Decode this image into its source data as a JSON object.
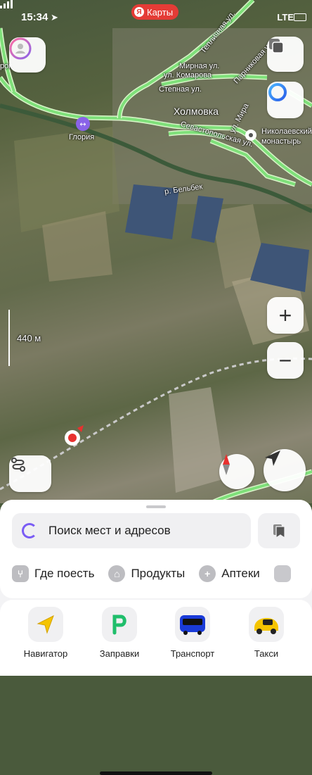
{
  "status_bar": {
    "time": "15:34",
    "network": "LTE"
  },
  "brand": {
    "label": "Карты",
    "logo_letter": "Я"
  },
  "map": {
    "labels": {
      "city": "Холмовка",
      "monastery": "Николаевский монастырь",
      "river": "р. Бельбек",
      "gym": "Глория",
      "streets": [
        "Тепличная ул.",
        "Мирная ул.",
        "ул. Комарова",
        "Степная ул.",
        "Парниковая ул.",
        "ул. Мира",
        "Севастопольская ул."
      ],
      "partial_left": "рок"
    },
    "scale_label": "440 м",
    "colors": {
      "road": "#7fe07a",
      "road_halo": "#d9f5c9",
      "pin": "#e8312f"
    }
  },
  "controls": {
    "zoom_in": "+",
    "zoom_out": "−"
  },
  "search": {
    "placeholder": "Поиск мест и адресов"
  },
  "categories": [
    {
      "icon": "fork-knife-icon",
      "label": "Где поесть"
    },
    {
      "icon": "basket-icon",
      "label": "Продукты"
    },
    {
      "icon": "plus-icon",
      "label": "Аптеки"
    }
  ],
  "apps": [
    {
      "icon": "navigator-arrow-icon",
      "label": "Навигатор"
    },
    {
      "icon": "fuel-p-icon",
      "label": "Заправки"
    },
    {
      "icon": "bus-icon",
      "label": "Транспорт"
    },
    {
      "icon": "taxi-icon",
      "label": "Такси"
    }
  ]
}
